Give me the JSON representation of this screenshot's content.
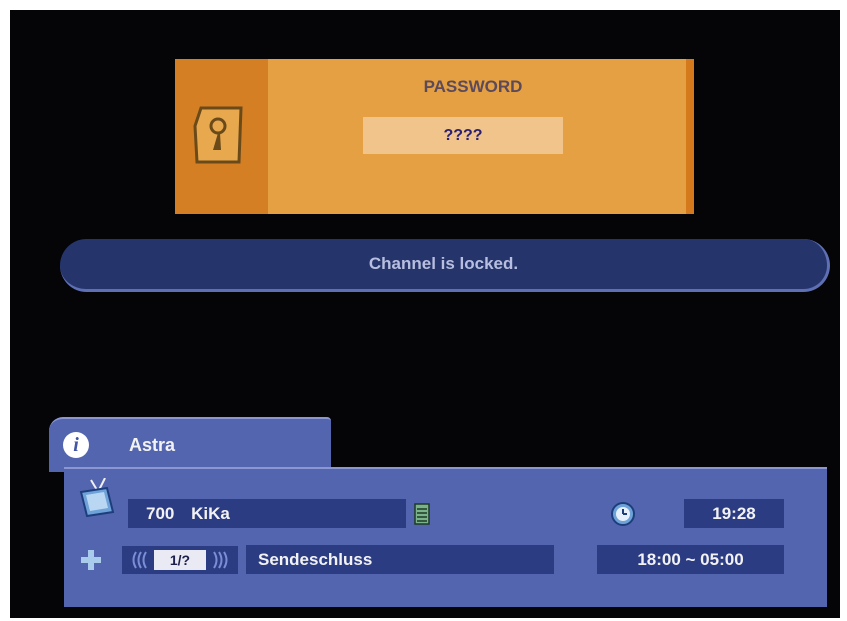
{
  "dialog": {
    "title": "PASSWORD",
    "input_value": "????"
  },
  "banner": {
    "message": "Channel is locked."
  },
  "info": {
    "satellite": "Astra",
    "channel_number": "700",
    "channel_name": "KiKa",
    "time": "19:28",
    "page": "1/?",
    "program_title": "Sendeschluss",
    "program_time": "18:00 ~ 05:00"
  },
  "colors": {
    "dialog_bg": "#e4a043",
    "dialog_accent": "#d47f24",
    "panel_bg": "#5465b0",
    "field_bg": "#2c3c82",
    "banner_bg": "#25356b"
  },
  "icons": [
    "key-icon",
    "info-icon",
    "tv-icon",
    "list-icon",
    "clock-icon",
    "plus-icon"
  ]
}
